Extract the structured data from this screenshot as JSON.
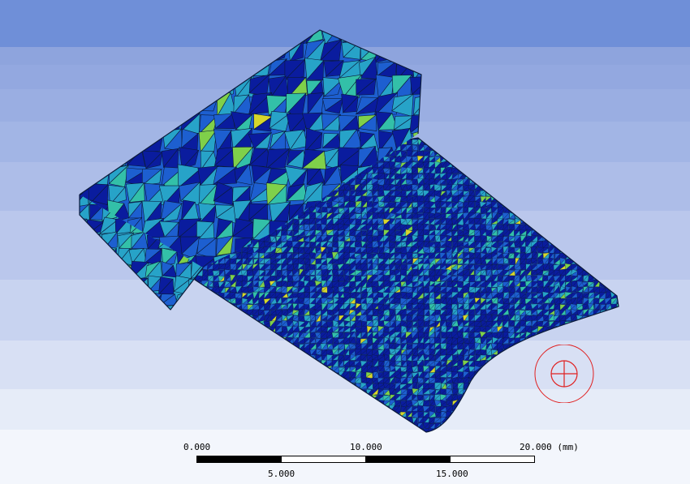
{
  "viewport": {
    "name": "Mesh Graphics Viewport",
    "model": {
      "mesh_colors": [
        "#0a1c9e",
        "#1d5fd0",
        "#27a3c8",
        "#33c0a8",
        "#7fd04a",
        "#d6d62c",
        "#d63a1a"
      ],
      "edge_color": "#0b1a3a"
    }
  },
  "scale_bar": {
    "tick_top": [
      "0.000",
      "10.000",
      "20.000 (mm)"
    ],
    "tick_bottom": [
      "5.000",
      "15.000"
    ]
  },
  "triad": {
    "icon": "rotation-center-icon",
    "color": "#e02020"
  }
}
